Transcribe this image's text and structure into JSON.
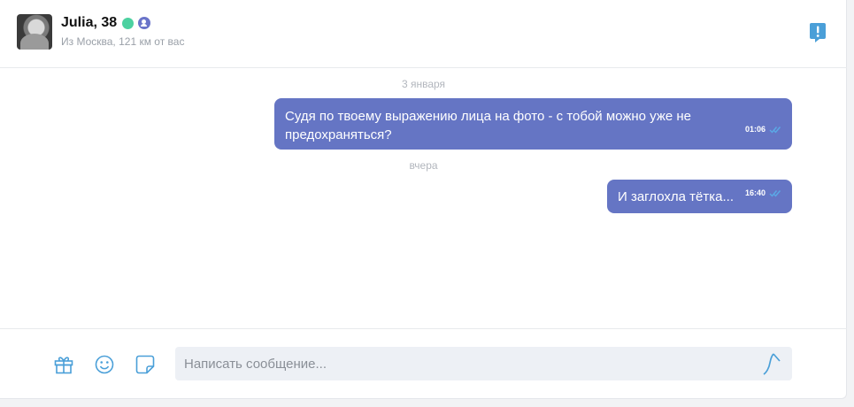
{
  "header": {
    "name": "Julia, 38",
    "location": "Из Москва, 121 км от вас",
    "icons": [
      "online-dot",
      "verified-user-icon",
      "report-icon"
    ]
  },
  "messages": {
    "separators": [
      "3 января",
      "вчера"
    ],
    "items": [
      {
        "text": "Судя по твоему выражению лица на фото - с тобой можно уже не предохраняться?",
        "time": "01:06",
        "status": "read"
      },
      {
        "text": "И заглохла тётка...",
        "time": "16:40",
        "status": "read"
      }
    ]
  },
  "composer": {
    "placeholder": "Написать сообщение...",
    "value": "",
    "icons": [
      "gift-icon",
      "emoji-icon",
      "sticker-icon",
      "send-icon"
    ]
  },
  "colors": {
    "bubble": "#6575c4",
    "accent": "#4a9fd8",
    "online": "#4cd1a0"
  }
}
